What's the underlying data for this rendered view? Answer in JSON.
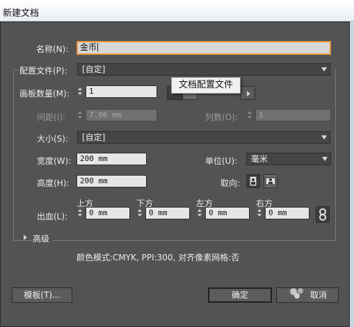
{
  "window": {
    "title": "新建文档"
  },
  "name": {
    "label": "名称(N):",
    "value": "金币"
  },
  "profile": {
    "label": "配置文件(P):",
    "value": "[自定]",
    "tooltip": "文档配置文件"
  },
  "artboards": {
    "label": "画板数量(M):",
    "value": "1"
  },
  "spacing": {
    "label": "间距(I):",
    "value": "7.06 mm"
  },
  "columns": {
    "label": "列数(O):",
    "value": "1"
  },
  "size": {
    "label": "大小(S):",
    "value": "[自定]"
  },
  "width": {
    "label": "宽度(W):",
    "value": "200 mm"
  },
  "units": {
    "label": "单位(U):",
    "value": "毫米"
  },
  "height": {
    "label": "高度(H):",
    "value": "200 mm"
  },
  "orientation": {
    "label": "取向:"
  },
  "bleed": {
    "label": "出血(L):",
    "top_label": "上方",
    "top": "0 mm",
    "bottom_label": "下方",
    "bottom": "0 mm",
    "left_label": "左方",
    "left": "0 mm",
    "right_label": "右方",
    "right": "0 mm"
  },
  "advanced": {
    "label": "高级"
  },
  "summary": {
    "text": "颜色模式:CMYK, PPI:300, 对齐像素网格:否"
  },
  "buttons": {
    "templates": "模板(T)...",
    "ok": "确定",
    "cancel": "取消"
  },
  "icons": {
    "spin": "spinner-arrows-icon",
    "dropdown": "chevron-down-icon",
    "portrait": "portrait-orientation-icon",
    "landscape": "landscape-orientation-icon",
    "link": "link-chain-icon",
    "disclosure": "disclosure-triangle-icon"
  },
  "colors": {
    "panel": "#535353",
    "focus_ring": "#e8953a",
    "field": "#e6e6e6"
  }
}
